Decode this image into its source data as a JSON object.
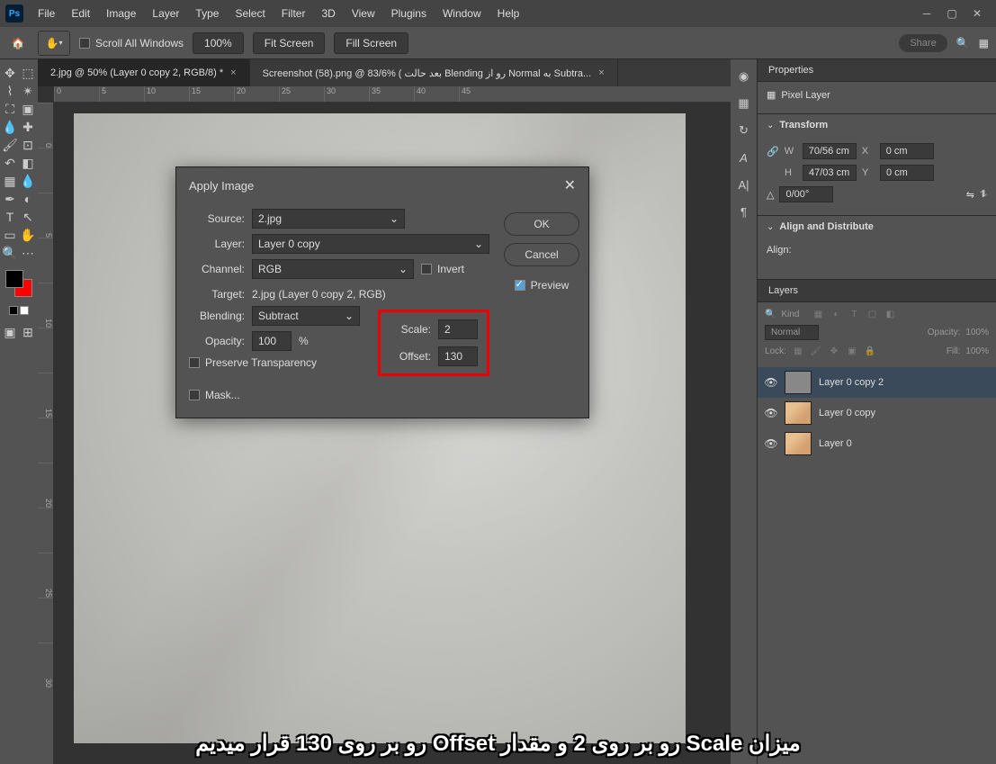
{
  "menu": [
    "File",
    "Edit",
    "Image",
    "Layer",
    "Type",
    "Select",
    "Filter",
    "3D",
    "View",
    "Plugins",
    "Window",
    "Help"
  ],
  "options": {
    "scroll_all": "Scroll All Windows",
    "zoom": "100%",
    "fit": "Fit Screen",
    "fill": "Fill Screen",
    "share": "Share"
  },
  "tabs": [
    {
      "label": "2.jpg @ 50% (Layer 0 copy 2, RGB/8) *",
      "active": true
    },
    {
      "label": "Screenshot (58).png @ 83/6% ( بعد حالت Blending رو از Normal به Subtra...",
      "active": false
    }
  ],
  "ruler_h": [
    "0",
    "5",
    "10",
    "15",
    "20",
    "25",
    "30",
    "35",
    "40",
    "45"
  ],
  "ruler_v": [
    "0",
    "",
    "5",
    "",
    "10",
    "",
    "15",
    "",
    "20",
    "",
    "25",
    "",
    "30"
  ],
  "dialog": {
    "title": "Apply Image",
    "source_label": "Source:",
    "source_val": "2.jpg",
    "layer_label": "Layer:",
    "layer_val": "Layer 0 copy",
    "channel_label": "Channel:",
    "channel_val": "RGB",
    "invert": "Invert",
    "target_label": "Target:",
    "target_val": "2.jpg (Layer 0 copy 2, RGB)",
    "blending_label": "Blending:",
    "blending_val": "Subtract",
    "opacity_label": "Opacity:",
    "opacity_val": "100",
    "opacity_unit": "%",
    "preserve": "Preserve Transparency",
    "mask": "Mask...",
    "scale_label": "Scale:",
    "scale_val": "2",
    "offset_label": "Offset:",
    "offset_val": "130",
    "ok": "OK",
    "cancel": "Cancel",
    "preview": "Preview"
  },
  "properties": {
    "tab": "Properties",
    "kind": "Pixel Layer",
    "transform": "Transform",
    "w": "W",
    "w_val": "70/56 cm",
    "h": "H",
    "h_val": "47/03 cm",
    "x": "X",
    "x_val": "0 cm",
    "y": "Y",
    "y_val": "0 cm",
    "angle": "0/00°",
    "align_head": "Align and Distribute",
    "align": "Align:"
  },
  "layers_panel": {
    "tab": "Layers",
    "kind": "Kind",
    "mode": "Normal",
    "opacity_label": "Opacity:",
    "opacity": "100%",
    "lock": "Lock:",
    "fill_label": "Fill:",
    "fill": "100%",
    "layers": [
      {
        "name": "Layer 0 copy 2",
        "active": true,
        "thumb": "gray"
      },
      {
        "name": "Layer 0 copy",
        "active": false,
        "thumb": "face"
      },
      {
        "name": "Layer 0",
        "active": false,
        "thumb": "face"
      }
    ]
  },
  "caption": "میزان Scale رو بر روی 2 و مقدار Offset رو بر روی 130 قرار میدیم"
}
